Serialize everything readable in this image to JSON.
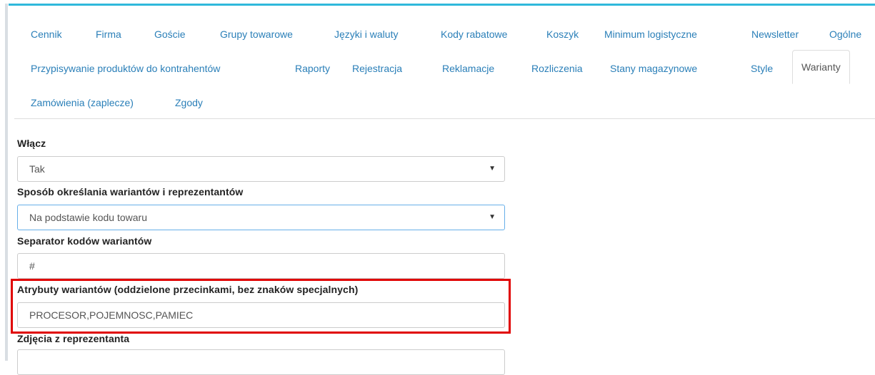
{
  "tabs": {
    "row1": [
      "Cennik",
      "Firma",
      "Goście",
      "Grupy towarowe",
      "Języki i waluty",
      "Kody rabatowe",
      "Koszyk",
      "Minimum logistyczne",
      "Newsletter",
      "Ogólne"
    ],
    "row2": [
      "Przypisywanie produktów do kontrahentów",
      "Raporty",
      "Rejestracja",
      "Reklamacje",
      "Rozliczenia",
      "Stany magazynowe",
      "Style",
      "Warianty"
    ],
    "row3": [
      "Zamówienia (zaplecze)",
      "Zgody"
    ],
    "active": "Warianty"
  },
  "form": {
    "enable_label": "Włącz",
    "enable_value": "Tak",
    "method_label": "Sposób określania wariantów i reprezentantów",
    "method_value": "Na podstawie kodu towaru",
    "separator_label": "Separator kodów wariantów",
    "separator_value": "#",
    "attributes_label": "Atrybuty wariantów (oddzielone przecinkami, bez znaków specjalnych)",
    "attributes_value": "PROCESOR,POJEMNOSC,PAMIEC",
    "photos_label": "Zdjęcia z reprezentanta"
  },
  "icons": {
    "dropdown": "caret-down-icon"
  },
  "colors": {
    "accent": "#30b8db",
    "link": "#2a7fb8",
    "highlight": "#e00000"
  }
}
